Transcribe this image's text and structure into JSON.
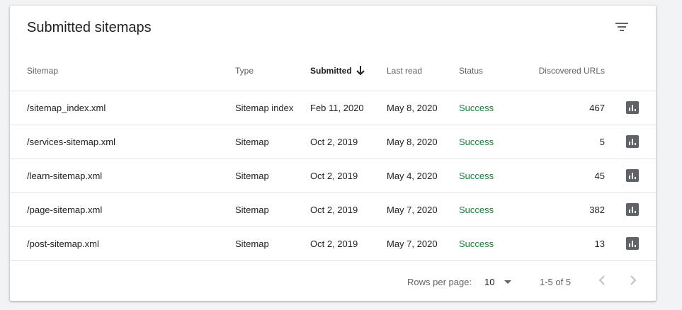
{
  "card": {
    "title": "Submitted sitemaps"
  },
  "table": {
    "headers": {
      "sitemap": "Sitemap",
      "type": "Type",
      "submitted": "Submitted",
      "last_read": "Last read",
      "status": "Status",
      "discovered": "Discovered URLs"
    },
    "sorted_column": "submitted",
    "sort_direction": "descending",
    "rows": [
      {
        "sitemap": "/sitemap_index.xml",
        "type": "Sitemap index",
        "submitted": "Feb 11, 2020",
        "last_read": "May 8, 2020",
        "status": "Success",
        "discovered": "467"
      },
      {
        "sitemap": "/services-sitemap.xml",
        "type": "Sitemap",
        "submitted": "Oct 2, 2019",
        "last_read": "May 8, 2020",
        "status": "Success",
        "discovered": "5"
      },
      {
        "sitemap": "/learn-sitemap.xml",
        "type": "Sitemap",
        "submitted": "Oct 2, 2019",
        "last_read": "May 4, 2020",
        "status": "Success",
        "discovered": "45"
      },
      {
        "sitemap": "/page-sitemap.xml",
        "type": "Sitemap",
        "submitted": "Oct 2, 2019",
        "last_read": "May 7, 2020",
        "status": "Success",
        "discovered": "382"
      },
      {
        "sitemap": "/post-sitemap.xml",
        "type": "Sitemap",
        "submitted": "Oct 2, 2019",
        "last_read": "May 7, 2020",
        "status": "Success",
        "discovered": "13"
      }
    ]
  },
  "pagination": {
    "rows_per_page_label": "Rows per page:",
    "rows_per_page_value": "10",
    "range_label": "1-5 of 5"
  },
  "icons": {
    "filter": "filter-icon",
    "sort": "arrow-down-icon",
    "row_action": "bar-chart-icon",
    "prev": "chevron-left-icon",
    "next": "chevron-right-icon",
    "dropdown": "caret-down-icon"
  },
  "colors": {
    "success": "#188038",
    "icon": "#5f6368"
  }
}
